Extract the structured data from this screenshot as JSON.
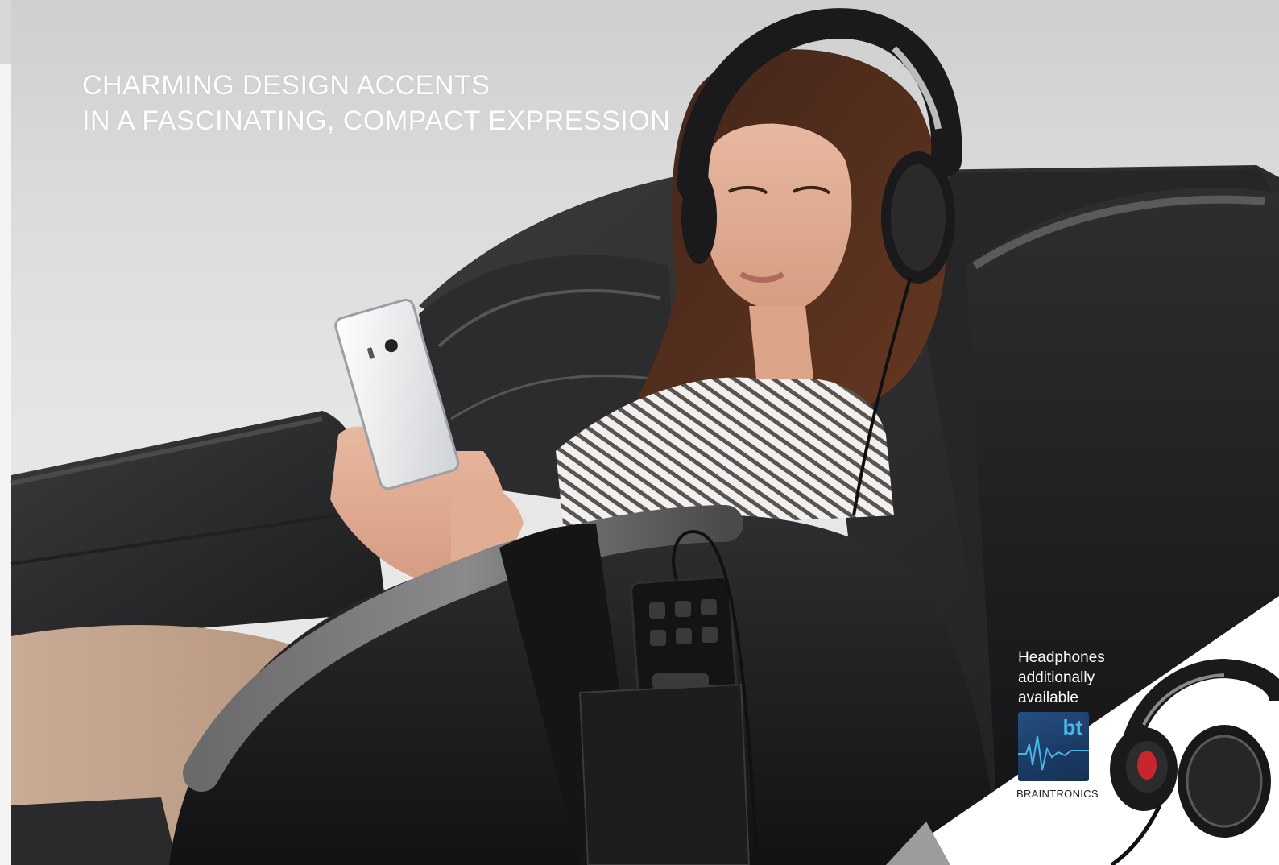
{
  "headline": {
    "line1": "CHARMING DESIGN ACCENTS",
    "line2": "IN A FASCINATING, COMPACT EXPRESSION"
  },
  "promo": {
    "line1": "Headphones",
    "line2": "additionally",
    "line3": "available"
  },
  "logo": {
    "mark_text": "bt",
    "brand_name": "BRAINTRONICS",
    "icon": "braintronics-logo"
  },
  "colors": {
    "background": "#e3e3e3",
    "headline_text": "#ffffff",
    "chair_leather": "#2a2a2c",
    "logo_blue": "#1f416b",
    "logo_accent": "#49b6e8"
  }
}
